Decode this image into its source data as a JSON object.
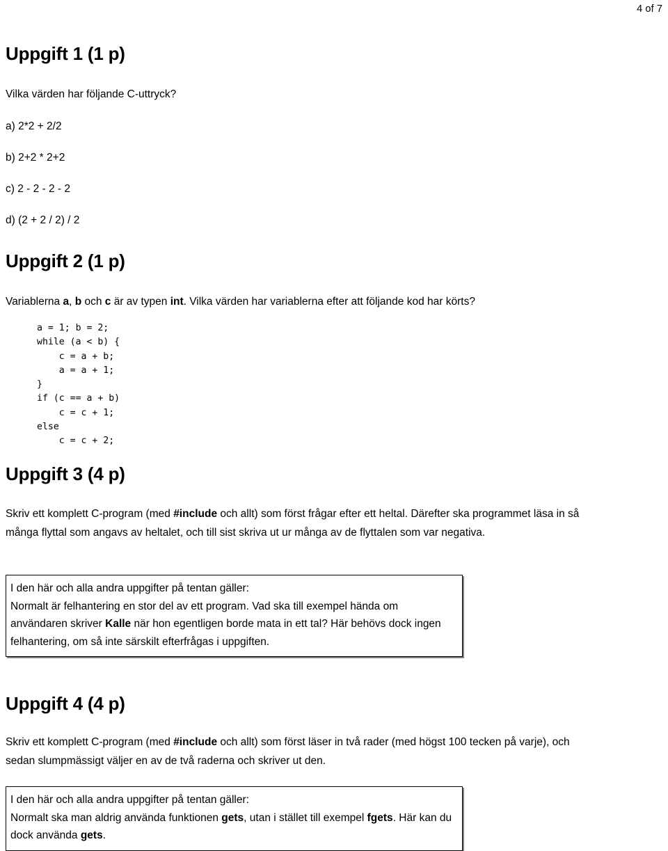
{
  "page": {
    "page_indicator": "4 of 7"
  },
  "sections": [
    {
      "heading": "Uppgift 1 (1 p)",
      "intro": "Vilka värden har följande C-uttryck?",
      "expressions": [
        "a) 2*2 + 2/2",
        "b) 2+2 * 2+2",
        "c) 2 - 2 - 2 - 2",
        "d) (2 + 2 / 2) / 2"
      ]
    },
    {
      "heading": "Uppgift 2 (1 p)",
      "intro_part1": "Variablerna ",
      "intro_bold_a": "a",
      "intro_part2": ", ",
      "intro_bold_b": "b",
      "intro_part3": " och ",
      "intro_bold_c": "c",
      "intro_part4": " är av typen ",
      "intro_bold_int": "int",
      "intro_part5": ". Vilka värden har variablerna efter att följande kod har körts?",
      "code": "a = 1; b = 2;\nwhile (a < b) {\n    c = a + b;\n    a = a + 1;\n}\nif (c == a + b)\n    c = c + 1;\nelse\n    c = c + 2;"
    },
    {
      "heading": "Uppgift 3 (4 p)",
      "intro_part1": "Skriv ett komplett C-program (med ",
      "intro_bold": "#include",
      "intro_part2": " och allt) som först frågar efter ett heltal. Därefter ska programmet läsa in så många flyttal som angavs av heltalet, och till sist skriva ut ur många av de flyttalen som var negativa.",
      "note": {
        "line1": "I den här och alla andra uppgifter på tentan gäller:",
        "line2_part1": "Normalt är felhantering en stor del av ett program. Vad ska till exempel hända om användaren skriver ",
        "line2_bold": "Kalle",
        "line2_part2": " när hon egentligen borde mata in ett tal? Här behövs dock ingen felhantering, om så inte särskilt efterfrågas i uppgiften."
      }
    },
    {
      "heading": "Uppgift 4 (4 p)",
      "intro_part1": "Skriv ett komplett C-program (med ",
      "intro_bold": "#include",
      "intro_part2": " och allt) som först läser in två rader (med högst 100 tecken på varje), och sedan slumpmässigt väljer en av de två raderna och skriver ut den.",
      "note": {
        "line1": "I den här och alla andra uppgifter på tentan gäller:",
        "line2_part1": "Normalt ska man aldrig använda funktionen ",
        "line2_bold1": "gets",
        "line2_part2": ", utan i stället till exempel ",
        "line2_bold2": "fgets",
        "line2_part3": ". Här kan du dock använda ",
        "line2_bold3": "gets",
        "line2_part4": "."
      }
    }
  ]
}
